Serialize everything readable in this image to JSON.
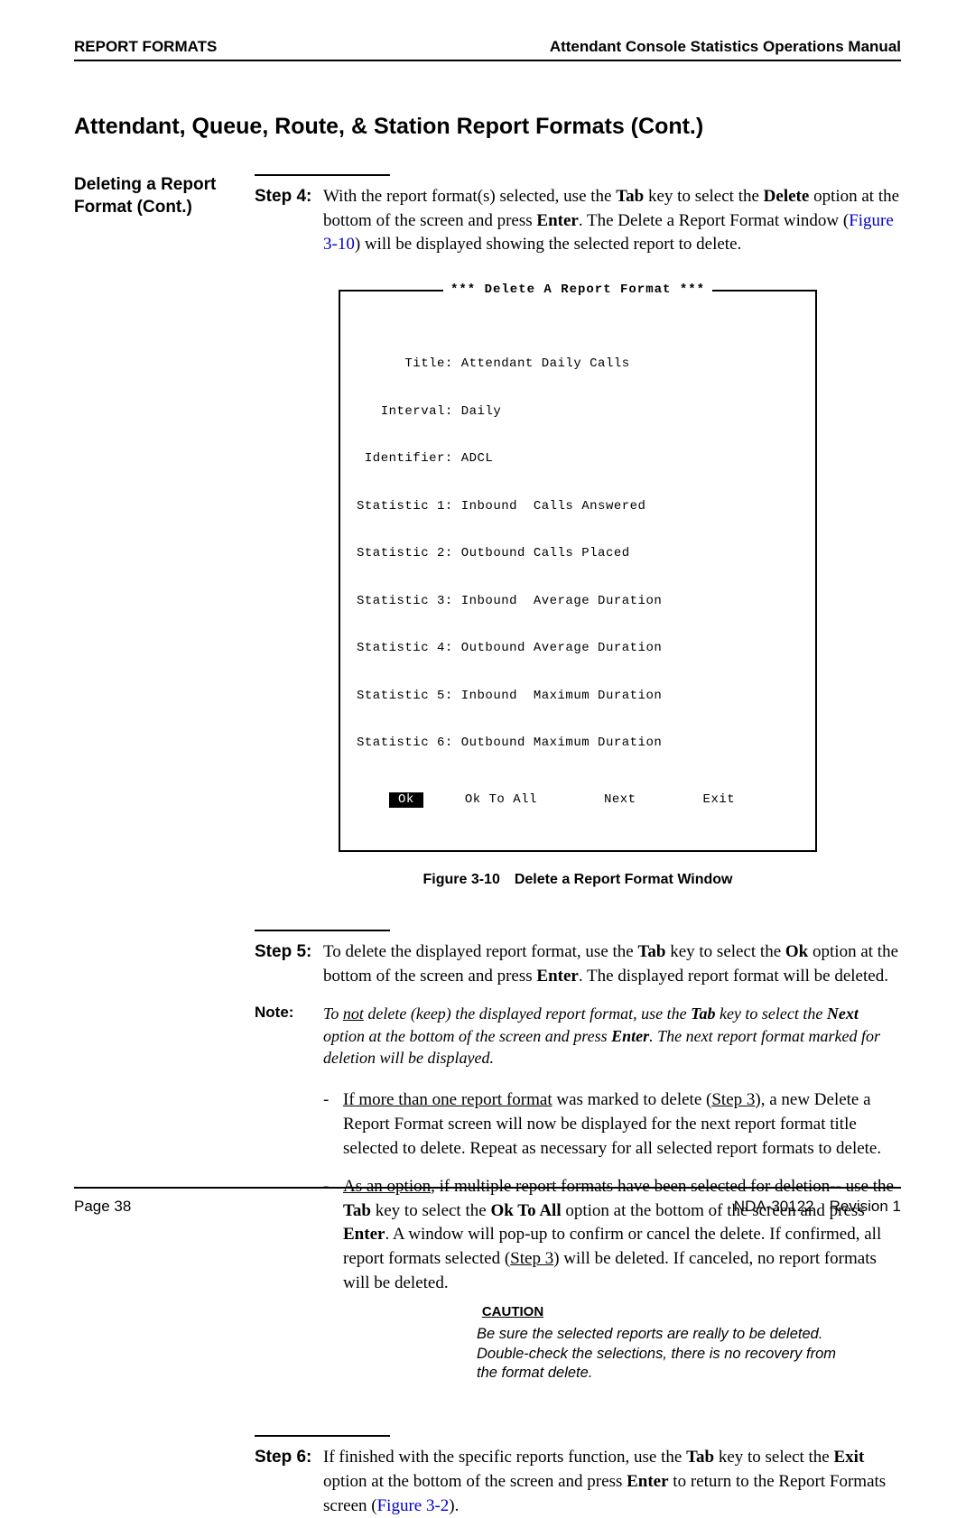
{
  "header": {
    "left": "REPORT FORMATS",
    "right": "Attendant Console Statistics Operations Manual"
  },
  "title": "Attendant, Queue, Route, & Station Report Formats (Cont.)",
  "sidebar": {
    "heading_line1": "Deleting a Report",
    "heading_line2": "Format (Cont.)"
  },
  "step4": {
    "label": "Step 4:",
    "t1": "With the report format(s) selected, use the ",
    "tab": "Tab",
    "t2": " key to select the ",
    "delete": "Delete",
    "t3": " option at the bottom of the screen and press ",
    "enter": "Enter",
    "t4": ". The Delete a Report Format window (",
    "ref": "Figure 3-10",
    "t5": ") will be displayed showing the selected report to delete."
  },
  "window": {
    "title": "*** Delete A Report Format ***",
    "rows": [
      "      Title: Attendant Daily Calls",
      "   Interval: Daily",
      " Identifier: ADCL",
      "Statistic 1: Inbound  Calls Answered",
      "Statistic 2: Outbound Calls Placed",
      "Statistic 3: Inbound  Average Duration",
      "Statistic 4: Outbound Average Duration",
      "Statistic 5: Inbound  Maximum Duration",
      "Statistic 6: Outbound Maximum Duration"
    ],
    "actions": {
      "ok": "Ok",
      "ok_all": "Ok To All",
      "next": "Next",
      "exit": "Exit"
    }
  },
  "figure_caption": "Figure 3-10 Delete a Report Format Window",
  "step5": {
    "label": "Step 5:",
    "t1": "To delete the displayed report format, use the ",
    "tab": "Tab",
    "t2": " key to select the ",
    "ok": "Ok",
    "t3": " option at the bottom of the screen and press ",
    "enter": "Enter",
    "t4": ". The displayed report format will be deleted."
  },
  "note": {
    "label": "Note:",
    "t1": "To ",
    "not": "not",
    "t2": " delete (keep) the displayed report format, use the ",
    "tab": "Tab",
    "t3": " key to select the ",
    "next": "Next",
    "t4": " option at the bottom of the screen and press ",
    "enter": "Enter",
    "t5": ". The next report format marked for deletion will be displayed."
  },
  "bullet1": {
    "u1": "If more than one report format",
    "t1": " was marked to delete (",
    "u2": "Step 3",
    "t2": "), a new Delete a Report Format screen will now be displayed for the next report format title selected to delete. Repeat as necessary for all selected report formats to delete."
  },
  "bullet2": {
    "u1": "As an option",
    "t1": ", if multiple report formats have been selected for deletion-- use the ",
    "tab": "Tab",
    "t2": " key to select the ",
    "okall": "Ok To All",
    "t3": " option at the bottom of the screen and press ",
    "enter": "Enter",
    "t4": ". A window will pop-up to confirm or cancel the delete. If confirmed, all report formats selected (",
    "u2": "Step 3",
    "t5": ") will be deleted. If canceled, no report formats will be deleted."
  },
  "caution": {
    "title": "CAUTION",
    "body": "Be sure the selected reports are really to be deleted. Double-check the selections, there is no recovery from the format delete."
  },
  "step6": {
    "label": "Step 6:",
    "t1": "If finished with the specific reports function, use the ",
    "tab": "Tab",
    "t2": " key to select the ",
    "exit": "Exit",
    "t3": " option at the bottom of the screen and press ",
    "enter": "Enter",
    "t4": " to return to the Report Formats screen (",
    "ref": "Figure 3-2",
    "t5": ")."
  },
  "footer": {
    "left": "Page 38",
    "right": "NDA-30122 Revision 1"
  }
}
